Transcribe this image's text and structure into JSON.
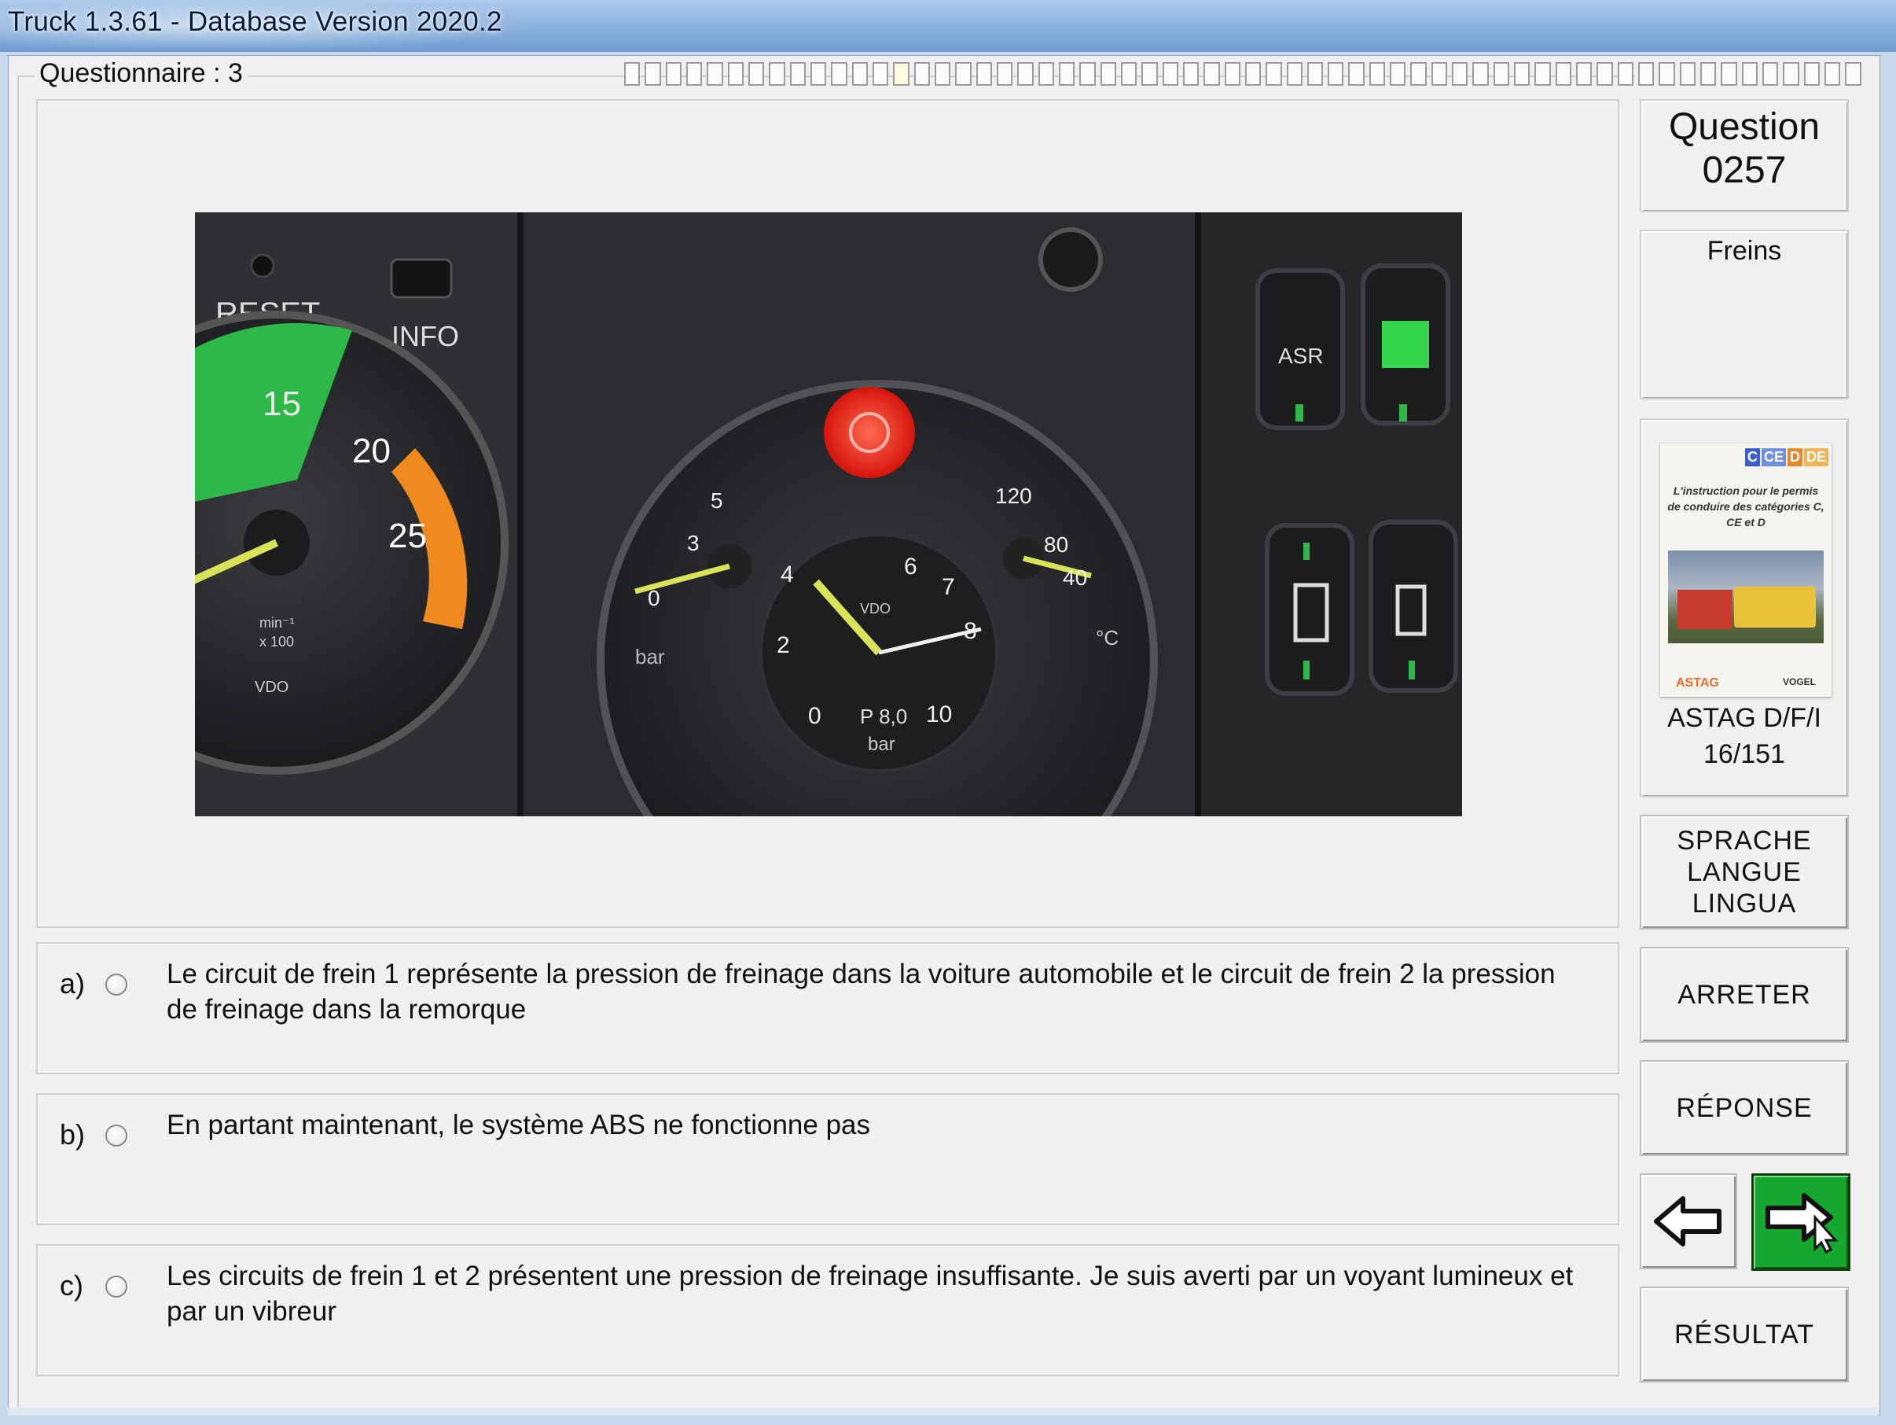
{
  "window": {
    "title": "Truck 1.3.61 - Database Version 2020.2"
  },
  "questionnaire": {
    "label": "Questionnaire : 3",
    "progress": {
      "total_cells": 60,
      "current_cell": 13
    }
  },
  "question": {
    "label": "Question",
    "number": "0257",
    "category": "Freins"
  },
  "photo": {
    "gauge_labels": {
      "reset": "RESET",
      "info": "INFO",
      "asr": "ASR",
      "rpm_ticks": [
        "15",
        "20",
        "25"
      ],
      "rpm_unit1": "min⁻¹",
      "rpm_unit2": "x 100",
      "brand": "VDO",
      "oil_ticks": [
        "0",
        "3",
        "5"
      ],
      "oil_unit": "bar",
      "pressure_ticks": [
        "0",
        "2",
        "4",
        "6",
        "7",
        "8",
        "10"
      ],
      "pressure_mark": "P 8,0",
      "pressure_unit": "bar",
      "temp_ticks": [
        "40",
        "80",
        "120"
      ],
      "temp_unit": "°C"
    }
  },
  "answers": [
    {
      "letter": "a)",
      "text": "Le circuit de frein 1 représente la pression de freinage dans la voiture automobile et le circuit de frein 2 la pression de freinage dans la remorque"
    },
    {
      "letter": "b)",
      "text": "En partant maintenant, le système ABS ne fonctionne pas"
    },
    {
      "letter": "c)",
      "text": "Les circuits de frein 1 et 2 présentent une pression de freinage insuffisante. Je suis averti par un voyant lumineux et par un vibreur"
    }
  ],
  "book": {
    "tags": [
      "C",
      "CE",
      "D",
      "DE"
    ],
    "title": "L'instruction pour le permis de conduire des catégories C, CE et D",
    "logo_left": "ASTAG",
    "logo_right": "VOGEL",
    "source_line1": "ASTAG D/F/I",
    "source_line2": "16/151"
  },
  "buttons": {
    "language": [
      "SPRACHE",
      "LANGUE",
      "LINGUA"
    ],
    "stop": "ARRETER",
    "answer": "RÉPONSE",
    "result": "RÉSULTAT"
  },
  "colors": {
    "next_button": "#16a82e",
    "warning_lamp": "#e8231b",
    "rpm_green": "#2fb84a",
    "rpm_orange": "#f08a1e"
  }
}
